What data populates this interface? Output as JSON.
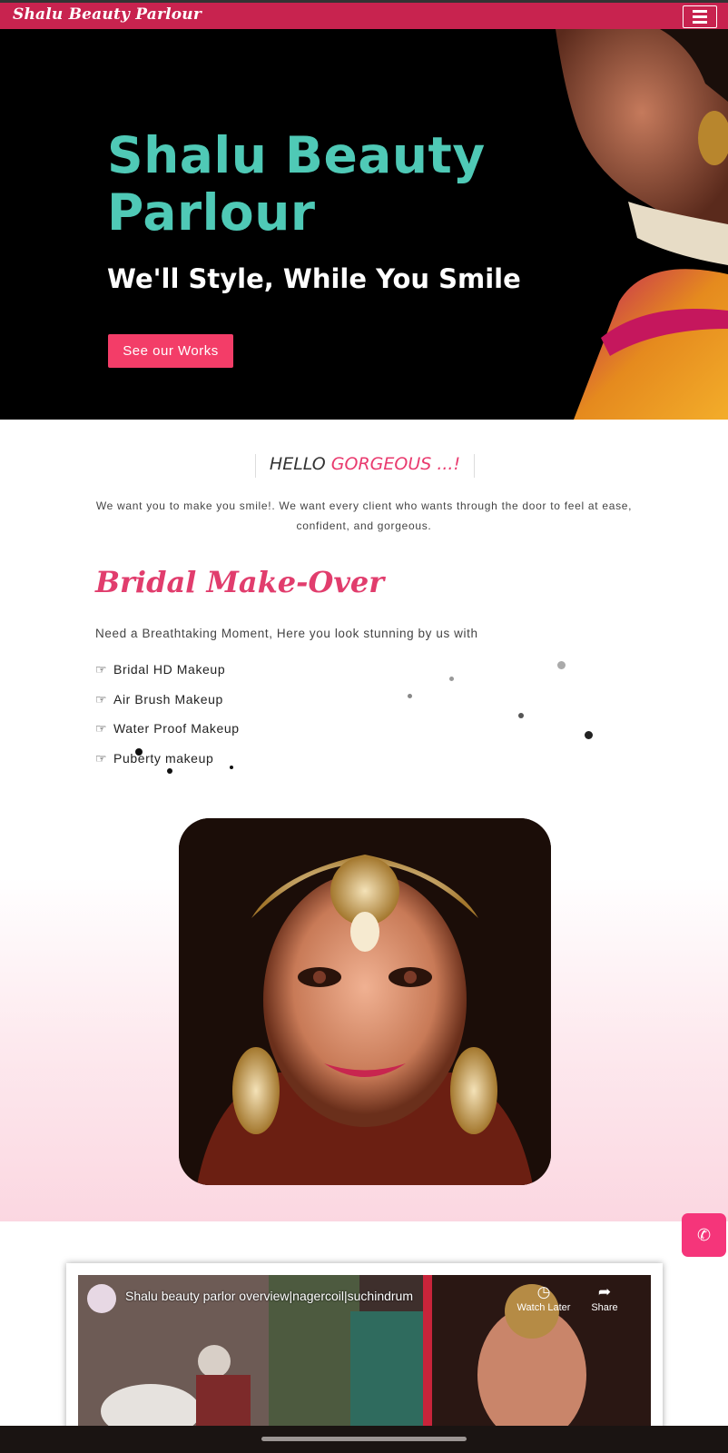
{
  "header": {
    "brand": "Shalu Beauty Parlour",
    "menu_icon": "hamburger-icon"
  },
  "hero": {
    "title": "Shalu Beauty Parlour",
    "tagline": "We'll Style, While You Smile",
    "cta_label": "See our Works"
  },
  "welcome": {
    "heading_plain": "HELLO ",
    "heading_accent": "GORGEOUS ...!",
    "text": "We want you to make you smile!. We want every client who wants through the door to feel at ease, confident, and gorgeous."
  },
  "bridal": {
    "title": "Bridal Make-Over",
    "subtitle": "Need a Breathtaking Moment, Here you look stunning by us with",
    "services": [
      "Bridal HD Makeup",
      "Air Brush Makeup",
      "Water Proof Makeup",
      "Puberty makeup"
    ]
  },
  "call": {
    "icon": "phone-icon"
  },
  "video": {
    "title": "Shalu beauty parlor overview|nagercoil|suchindrum",
    "watch_later": "Watch Later",
    "share": "Share"
  },
  "colors": {
    "topbar": "#c8234f",
    "accent": "#f33d68",
    "teal": "#4fc9b6",
    "pink_text": "#e13d6d"
  }
}
